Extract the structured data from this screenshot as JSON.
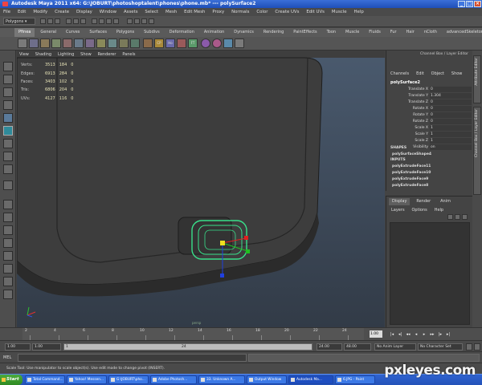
{
  "window": {
    "title": "Autodesk Maya 2011 x64: G:\\JOBURT\\photoshoptalent\\phones\\phone.mb* --- polySurface2"
  },
  "menubar": {
    "items": [
      "File",
      "Edit",
      "Modify",
      "Create",
      "Display",
      "Window",
      "Assets",
      "Select",
      "Mesh",
      "Edit Mesh",
      "Proxy",
      "Normals",
      "Color",
      "Create UVs",
      "Edit UVs",
      "Muscle",
      "Help"
    ]
  },
  "statusline": {
    "mode": "Polygons"
  },
  "shelf": {
    "tabs": [
      "Pfinea",
      "General",
      "Curves",
      "Surfaces",
      "Polygons",
      "Subdivs",
      "Deformation",
      "Animation",
      "Dynamics",
      "Rendering",
      "PaintEffects",
      "Toon",
      "Muscle",
      "Fluids",
      "Fur",
      "Hair",
      "nCloth",
      "advancedSkeleton"
    ],
    "active_tab": 0,
    "icon_labels": [
      "CP",
      "Ho",
      "FT"
    ]
  },
  "viewport": {
    "menu": [
      "View",
      "Shading",
      "Lighting",
      "Show",
      "Renderer",
      "Panels"
    ],
    "hud": [
      {
        "label": "Verts:",
        "a": "3513",
        "b": "184",
        "c": "0"
      },
      {
        "label": "Edges:",
        "a": "6913",
        "b": "284",
        "c": "0"
      },
      {
        "label": "Faces:",
        "a": "3403",
        "b": "102",
        "c": "0"
      },
      {
        "label": "Tris:",
        "a": "6806",
        "b": "204",
        "c": "0"
      },
      {
        "label": "UVs:",
        "a": "4127",
        "b": "116",
        "c": "0"
      }
    ],
    "camera": "persp"
  },
  "channelbox": {
    "title": "Channel Box / Layer Editor",
    "menu": [
      "Channels",
      "Edit",
      "Object",
      "Show"
    ],
    "object": "polySurface2",
    "attributes": [
      {
        "name": "Translate X",
        "value": "0"
      },
      {
        "name": "Translate Y",
        "value": "1.304"
      },
      {
        "name": "Translate Z",
        "value": "0"
      },
      {
        "name": "Rotate X",
        "value": "0"
      },
      {
        "name": "Rotate Y",
        "value": "0"
      },
      {
        "name": "Rotate Z",
        "value": "0"
      },
      {
        "name": "Scale X",
        "value": "1"
      },
      {
        "name": "Scale Y",
        "value": "1"
      },
      {
        "name": "Scale Z",
        "value": "1"
      },
      {
        "name": "Visibility",
        "value": "on"
      }
    ],
    "shapes_header": "SHAPES",
    "shape": "polySurfaceShape4",
    "inputs_header": "INPUTS",
    "inputs": [
      "polyExtrudeFace11",
      "polyExtrudeFace10",
      "polyExtrudeFace9",
      "polyExtrudeFace8"
    ]
  },
  "layereditor": {
    "tabs": [
      "Display",
      "Render",
      "Anim"
    ],
    "active_tab": 0,
    "menu": [
      "Layers",
      "Options",
      "Help"
    ]
  },
  "sidetabs": [
    "Attribute Editor",
    "Channel Box / Layer Editor"
  ],
  "timeslider": {
    "labels": [
      "2",
      "4",
      "6",
      "8",
      "10",
      "12",
      "14",
      "16",
      "18",
      "20",
      "22",
      "24"
    ],
    "current_frame": "1.00"
  },
  "rangeslider": {
    "start": "1.00",
    "playback_start": "1.00",
    "range_start_label": "1",
    "range_end_label": "24",
    "playback_end": "24.00",
    "end": "48.00",
    "anim_layer": "No Anim Layer",
    "character_set": "No Character Set"
  },
  "cmdline": {
    "label": "MEL"
  },
  "helpline": {
    "text": "Scale Tool: Use manipulator to scale object(s). Use edit mode to change pivot (INSERT)."
  },
  "taskbar": {
    "start": "Start",
    "tasks": [
      "Total Command...",
      "Yahoo! Messen...",
      "G:\\JOBURT\\pho...",
      "Adobe Photosh...",
      "33. Unknown A...",
      "Output Window",
      "Autodesk Ma...",
      "6.JPG - Paint"
    ],
    "active_task": 6
  },
  "watermark": "pxleyes.com",
  "colors": {
    "selection": "#39e08a",
    "manip_x": "#e02020",
    "manip_y": "#20c020",
    "manip_z": "#2040e0",
    "pivot": "#f0e020"
  }
}
